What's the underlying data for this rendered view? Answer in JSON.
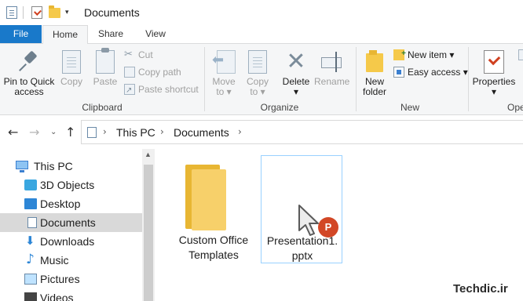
{
  "window": {
    "title": "Documents",
    "quick_access_dropdown": "▾"
  },
  "tabs": [
    {
      "label": "File"
    },
    {
      "label": "Home"
    },
    {
      "label": "Share"
    },
    {
      "label": "View"
    }
  ],
  "ribbon": {
    "clipboard": {
      "label": "Clipboard",
      "pin_line1": "Pin to Quick",
      "pin_line2": "access",
      "copy": "Copy",
      "paste": "Paste",
      "cut": "Cut",
      "copy_path": "Copy path",
      "paste_shortcut": "Paste shortcut"
    },
    "organize": {
      "label": "Organize",
      "move_line1": "Move",
      "move_line2": "to ▾",
      "copy_line1": "Copy",
      "copy_line2": "to ▾",
      "delete_line1": "Delete",
      "delete_line2": "▾",
      "rename": "Rename"
    },
    "new": {
      "label": "New",
      "new_folder_line1": "New",
      "new_folder_line2": "folder",
      "new_item": "New item ▾",
      "easy_access": "Easy access ▾"
    },
    "open": {
      "label": "Ope",
      "properties": "Properties",
      "properties_arrow": "▾"
    }
  },
  "address": {
    "back": "←",
    "forward": "→",
    "recent": "⌄",
    "up": "↑",
    "crumbs": [
      "This PC",
      "Documents"
    ],
    "separator": "›"
  },
  "navpane": {
    "items": [
      {
        "label": "This PC",
        "icon": "pc-icon"
      },
      {
        "label": "3D Objects",
        "icon": "3d-objects-icon"
      },
      {
        "label": "Desktop",
        "icon": "desktop-icon"
      },
      {
        "label": "Documents",
        "icon": "documents-icon"
      },
      {
        "label": "Downloads",
        "icon": "downloads-icon"
      },
      {
        "label": "Music",
        "icon": "music-icon"
      },
      {
        "label": "Pictures",
        "icon": "pictures-icon"
      },
      {
        "label": "Videos",
        "icon": "videos-icon"
      }
    ],
    "selected": "Documents",
    "scroll_up": "▲"
  },
  "files": [
    {
      "line1": "Custom Office",
      "line2": "Templates",
      "icon": "folder-icon"
    },
    {
      "line1": "Presentation1.",
      "line2": "pptx",
      "icon": "powerpoint-icon",
      "badge": "P"
    }
  ],
  "watermark": "Techdic.ir",
  "colors": {
    "file_tab": "#1979ca",
    "folder": "#f5c94a",
    "ppt": "#d24726",
    "ribbon_bg": "#f5f6f7"
  }
}
